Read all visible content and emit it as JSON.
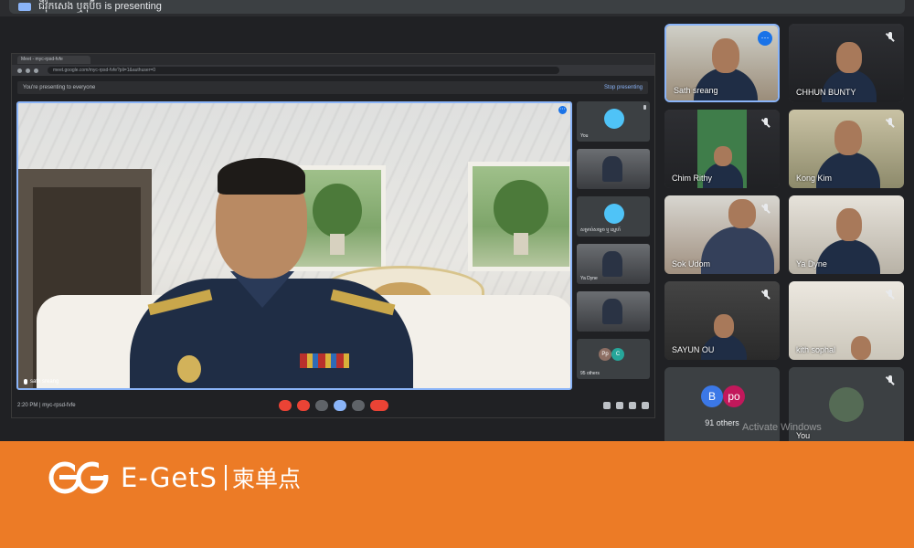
{
  "header": {
    "presenting_text": "ជីវ៉ុកសេង ឬតុប៊ិច is presenting"
  },
  "shared_screen": {
    "tab_title": "Meet - myc-rpsd-fvfe",
    "address": "meet.google.com/myc-rpsd-fvfe?pli=1&authuser=0",
    "presenting_notice": "You're presenting to everyone",
    "stop_presenting": "Stop presenting",
    "main_speaker_name": "sath sreang",
    "time_code": "2:20 PM  |  myc-rpsd-fvfe",
    "inner_tiles": [
      {
        "label": "You"
      },
      {
        "label": ""
      },
      {
        "label": "សម្រាប់សម្តេច ឬ ស្នេហ៍"
      },
      {
        "label": "Ya Dyne"
      },
      {
        "label": ""
      },
      {
        "label": "95 others"
      }
    ],
    "inner_avatars": [
      "Pp",
      "C"
    ]
  },
  "participants": [
    {
      "name": "Sath sreang",
      "muted": false,
      "active": true
    },
    {
      "name": "CHHUN BUNTY",
      "muted": true
    },
    {
      "name": "Chim Rithy",
      "muted": true
    },
    {
      "name": "Kong Kim",
      "muted": true
    },
    {
      "name": "Sok Udom",
      "muted": true
    },
    {
      "name": "Ya Dyne",
      "muted": true
    },
    {
      "name": "SAYUN OU",
      "muted": true
    },
    {
      "name": "kith sophal",
      "muted": true
    }
  ],
  "others": {
    "count_label": "91 others",
    "avatars": [
      "B",
      "po"
    ]
  },
  "self": {
    "name": "You"
  },
  "watermark": "Activate Windows",
  "banner": {
    "brand": "E-GetS",
    "brand_cn": "柬单点"
  },
  "colors": {
    "accent_blue": "#8ab4f8",
    "meet_bg": "#202124",
    "banner_orange": "#ec7b26",
    "end_call_red": "#ea4335"
  }
}
